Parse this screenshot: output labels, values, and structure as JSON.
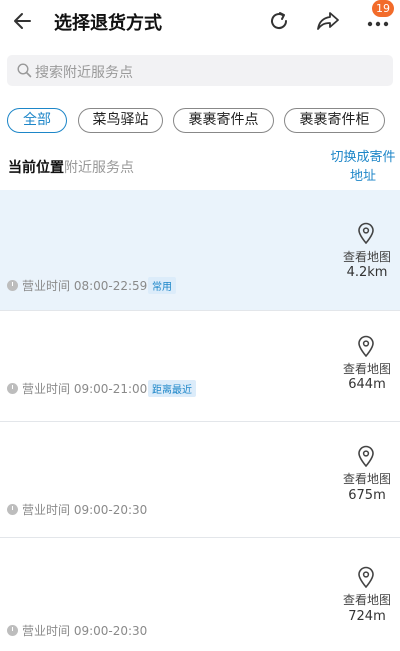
{
  "header": {
    "title": "选择退货方式",
    "notification_count": "19"
  },
  "search": {
    "placeholder": "搜索附近服务点"
  },
  "filters": [
    {
      "label": "全部",
      "active": true
    },
    {
      "label": "菜鸟驿站",
      "active": false
    },
    {
      "label": "裹裹寄件点",
      "active": false
    },
    {
      "label": "裹裹寄件柜",
      "active": false
    }
  ],
  "location": {
    "current_label": "当前位置",
    "nearby_label": "附近服务点",
    "switch_line1": "切换成寄件",
    "switch_line2": "地址"
  },
  "points": [
    {
      "hours": "营业时间 08:00-22:59",
      "tag": "常用",
      "map_label": "查看地图",
      "distance": "4.2km"
    },
    {
      "hours": "营业时间 09:00-21:00",
      "tag": "距离最近",
      "map_label": "查看地图",
      "distance": "644m"
    },
    {
      "hours": "营业时间 09:00-20:30",
      "tag": "",
      "map_label": "查看地图",
      "distance": "675m"
    },
    {
      "hours": "营业时间 09:00-20:30",
      "tag": "",
      "map_label": "查看地图",
      "distance": "724m"
    }
  ],
  "colors": {
    "accent": "#1d86c8",
    "badge": "#f26b2a",
    "highlight_row": "#eaf3fb"
  },
  "icons": [
    "back-arrow-icon",
    "refresh-icon",
    "share-icon",
    "more-icon",
    "search-icon",
    "location-pin-icon",
    "clock-icon"
  ]
}
